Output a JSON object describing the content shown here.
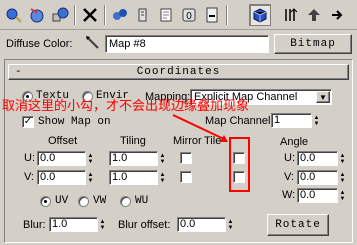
{
  "colors": {
    "annotation": "#ff0000",
    "panel_bg": "#d4d0c8"
  },
  "toolbar": {
    "icons": [
      "pick-material-icon",
      "put-to-scene-icon",
      "assign-to-selection-icon",
      "delete-icon",
      "make-unique-icon",
      "put-to-library-icon",
      "effect-channel-icon",
      "show-map-icon",
      "show-end-result-icon",
      "go-to-parent-icon",
      "go-forward-icon"
    ],
    "channel_value": "0"
  },
  "diffuse": {
    "label": "Diffuse Color:",
    "map_name": "Map #8",
    "type_button": "Bitmap"
  },
  "rollout": {
    "minus": "-",
    "title": "Coordinates"
  },
  "coords": {
    "texture_label": "Textu",
    "environ_label": "Envir",
    "mapping_label": "Mapping:",
    "mapping_value": "Explicit Map Channel",
    "show_map_on": "Show Map on",
    "map_channel_label": "Map Channel:",
    "map_channel_value": "1",
    "offset_label": "Offset",
    "tiling_label": "Tiling",
    "mirror_label": "Mirror",
    "tile_label": "Tile",
    "angle_label": "Angle",
    "u_label": "U:",
    "v_label": "V:",
    "w_label": "W:",
    "offset_u": "0.0",
    "offset_v": "0.0",
    "tiling_u": "1.0",
    "tiling_v": "1.0",
    "angle_u": "0.0",
    "angle_v": "0.0",
    "angle_w": "0.0",
    "uv": "UV",
    "vw": "VW",
    "wu": "WU",
    "blur_label": "Blur:",
    "blur_value": "1.0",
    "blur_offset_label": "Blur offset:",
    "blur_offset_value": "0.0",
    "rotate_label": "Rotate"
  },
  "annotation": {
    "text": "取消这里的小勾，才不会出现边缘叠加现象"
  }
}
